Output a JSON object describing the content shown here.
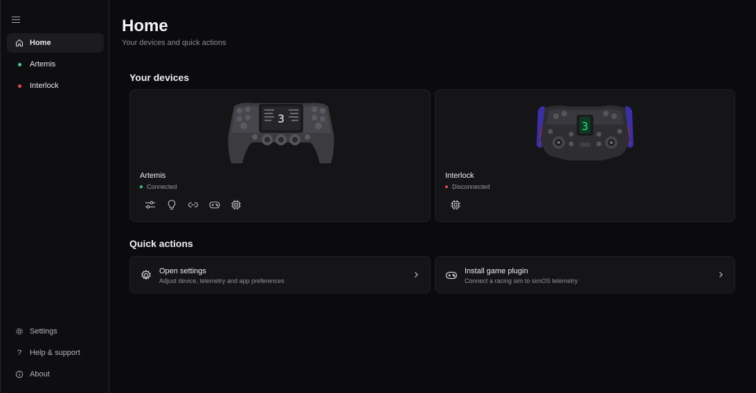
{
  "sidebar": {
    "menu_icon": "hamburger-icon",
    "items": [
      {
        "label": "Home",
        "icon": "home-icon"
      },
      {
        "label": "Artemis",
        "status_color": "#3ecf8e"
      },
      {
        "label": "Interlock",
        "status_color": "#e5484d"
      }
    ],
    "bottom": [
      {
        "label": "Settings",
        "icon": "gear-icon"
      },
      {
        "label": "Help & support",
        "icon": "question-icon"
      },
      {
        "label": "About",
        "icon": "info-icon"
      }
    ]
  },
  "header": {
    "title": "Home",
    "subtitle": "Your devices and quick actions"
  },
  "devices": {
    "section_title": "Your devices",
    "items": [
      {
        "name": "Artemis",
        "status": "Connected",
        "status_color": "#3ecf8e",
        "tools": [
          "sliders-icon",
          "lightbulb-icon",
          "link-icon",
          "gamepad-icon",
          "chip-icon"
        ]
      },
      {
        "name": "Interlock",
        "status": "Disconnected",
        "status_color": "#e5484d",
        "tools": [
          "chip-icon"
        ]
      }
    ]
  },
  "quick_actions": {
    "section_title": "Quick actions",
    "items": [
      {
        "title": "Open settings",
        "description": "Adjust device, telemetry and app preferences",
        "icon": "gear-icon"
      },
      {
        "title": "Install game plugin",
        "description": "Connect a racing sim to simOS telemetry",
        "icon": "gamepad-icon"
      }
    ]
  }
}
